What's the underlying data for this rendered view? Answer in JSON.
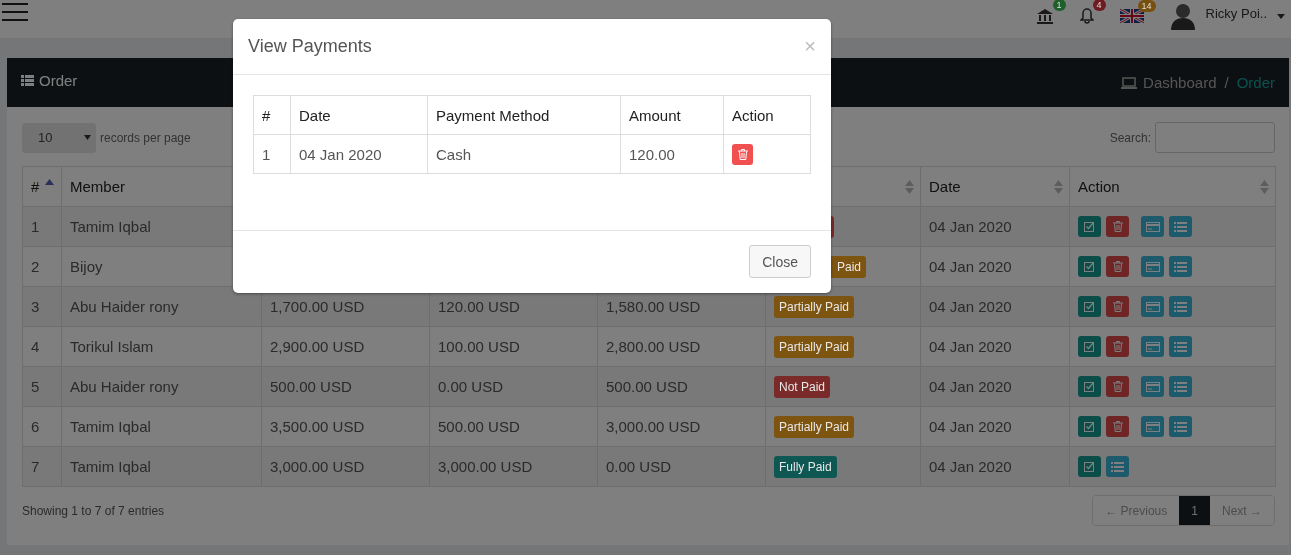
{
  "topbar": {
    "notifications": [
      {
        "kind": "bank",
        "count": "1",
        "color": "#1e5f2a"
      },
      {
        "kind": "bell",
        "count": "4",
        "color": "#6e1c21"
      },
      {
        "kind": "flag",
        "count": "14",
        "color": "#78500d"
      }
    ],
    "user": "Ricky Poi.."
  },
  "page_header": {
    "title": "Order",
    "separator": "/",
    "breadcrumb": [
      {
        "label": "Dashboard",
        "selected": false
      },
      {
        "label": "Order",
        "selected": true
      }
    ]
  },
  "length_menu": {
    "value": "10",
    "label": "records per page"
  },
  "search": {
    "label": "Search:"
  },
  "table": {
    "columns": [
      {
        "label": "#",
        "sorted": true,
        "sortable": true
      },
      {
        "label": "Member"
      },
      {},
      {},
      {},
      {
        "sorted": false,
        "sortable": true
      },
      {
        "label": "Date",
        "sorted": false,
        "sortable": true
      },
      {
        "label": "Action",
        "sorted": false,
        "sortable": true
      }
    ],
    "rows": [
      {
        "no": "1",
        "member": "Tamim Iqbal",
        "status": {
          "color": "#7a2a28",
          "cut": true
        },
        "date": "04 Jan 2020",
        "actions": [
          {
            "kind": "edit"
          },
          {
            "kind": "delete"
          },
          {
            "kind": "card"
          },
          {
            "kind": "list"
          }
        ]
      },
      {
        "no": "2",
        "member": "Bijoy",
        "status": {
          "label": "Paid",
          "color": "#7d5410",
          "cut": true
        },
        "date": "04 Jan 2020",
        "actions": [
          {
            "kind": "edit"
          },
          {
            "kind": "delete"
          },
          {
            "kind": "card"
          },
          {
            "kind": "list"
          }
        ]
      },
      {
        "no": "3",
        "member": "Abu Haider rony",
        "amount": "1,700.00 USD",
        "paid": "120.00 USD",
        "due": "1,580.00 USD",
        "status": {
          "label": "Partially Paid",
          "color": "#7d5410"
        },
        "date": "04 Jan 2020",
        "actions": [
          {
            "kind": "edit"
          },
          {
            "kind": "delete"
          },
          {
            "kind": "card"
          },
          {
            "kind": "list"
          }
        ]
      },
      {
        "no": "4",
        "member": "Torikul Islam",
        "amount": "2,900.00 USD",
        "paid": "100.00 USD",
        "due": "2,800.00 USD",
        "status": {
          "label": "Partially Paid",
          "color": "#7d5410"
        },
        "date": "04 Jan 2020",
        "actions": [
          {
            "kind": "edit"
          },
          {
            "kind": "delete"
          },
          {
            "kind": "card"
          },
          {
            "kind": "list"
          }
        ]
      },
      {
        "no": "5",
        "member": "Abu Haider rony",
        "amount": "500.00 USD",
        "paid": "0.00 USD",
        "due": "500.00 USD",
        "status": {
          "label": "Not Paid",
          "color": "#7a2a28"
        },
        "date": "04 Jan 2020",
        "actions": [
          {
            "kind": "edit"
          },
          {
            "kind": "delete"
          },
          {
            "kind": "card"
          },
          {
            "kind": "list"
          }
        ]
      },
      {
        "no": "6",
        "member": "Tamim Iqbal",
        "amount": "3,500.00 USD",
        "paid": "500.00 USD",
        "due": "3,000.00 USD",
        "status": {
          "label": "Partially Paid",
          "color": "#7d5410"
        },
        "date": "04 Jan 2020",
        "actions": [
          {
            "kind": "edit"
          },
          {
            "kind": "delete"
          },
          {
            "kind": "card"
          },
          {
            "kind": "list"
          }
        ]
      },
      {
        "no": "7",
        "member": "Tamim Iqbal",
        "amount": "3,000.00 USD",
        "paid": "3,000.00 USD",
        "due": "0.00 USD",
        "status": {
          "label": "Fully Paid",
          "color": "#0f5753"
        },
        "date": "04 Jan 2020",
        "actions": [
          {
            "kind": "edit"
          },
          {
            "kind": "list"
          }
        ]
      }
    ]
  },
  "info": "Showing 1 to 7 of 7 entries",
  "pagination": [
    {
      "label": "← Previous",
      "selected": false
    },
    {
      "label": "1",
      "selected": true
    },
    {
      "label": "Next →",
      "selected": false
    }
  ],
  "modal": {
    "title": "View Payments",
    "close": "×",
    "columns": [
      "#",
      "Date",
      "Payment Method",
      "Amount",
      "Action"
    ],
    "rows": [
      {
        "no": "1",
        "date": "04 Jan 2020",
        "method": "Cash",
        "amount": "120.00",
        "actions": [
          {
            "kind": "delete"
          }
        ]
      }
    ],
    "footer_button": "Close"
  }
}
